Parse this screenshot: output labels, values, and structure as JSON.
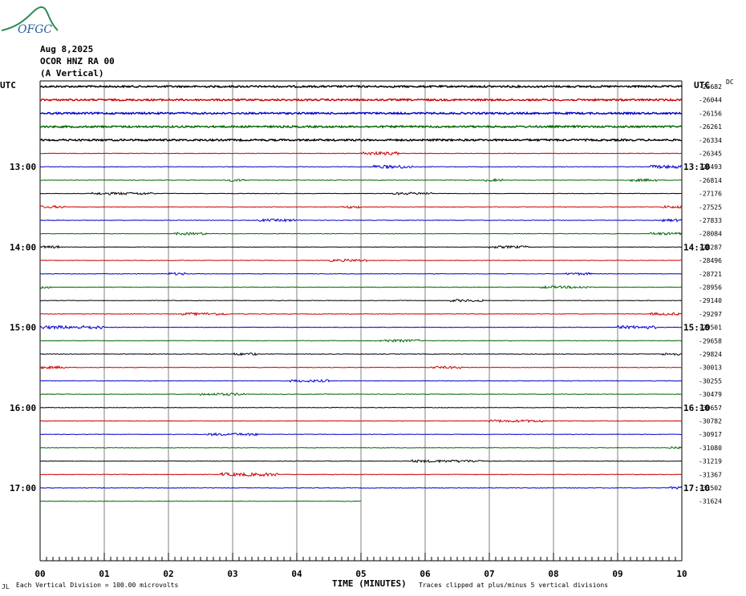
{
  "header": {
    "logo_text": "OFGC",
    "date": "Aug 8,2025",
    "station": "OCOR HNZ RA 00",
    "component": "(A Vertical)"
  },
  "colors": {
    "cycle": [
      "#000000",
      "#cc0000",
      "#0000cc",
      "#006600"
    ],
    "grid": "#808080",
    "logo": "#2e8b57"
  },
  "chart_data": {
    "type": "line",
    "title": "Aug 8,2025 OCOR HNZ RA 00 (A Vertical)",
    "xlabel": "TIME (MINUTES)",
    "ylabel": "UTC",
    "x_ticks": [
      "00",
      "01",
      "02",
      "03",
      "04",
      "05",
      "06",
      "07",
      "08",
      "09",
      "10"
    ],
    "xlim": [
      0,
      10
    ],
    "left_axis_label": "UTC",
    "right_axis_label": "UTC",
    "left_time_labels": [
      {
        "trace": 6,
        "label": "13:00"
      },
      {
        "trace": 12,
        "label": "14:00"
      },
      {
        "trace": 18,
        "label": "15:00"
      },
      {
        "trace": 24,
        "label": "16:00"
      },
      {
        "trace": 30,
        "label": "17:00"
      }
    ],
    "right_time_labels": [
      {
        "trace": 6,
        "label": "13:10"
      },
      {
        "trace": 12,
        "label": "14:10"
      },
      {
        "trace": 18,
        "label": "15:10"
      },
      {
        "trace": 24,
        "label": "16:10"
      },
      {
        "trace": 30,
        "label": "17:10"
      }
    ],
    "first_trace_note": "DC",
    "trace_offsets": [
      "-25682",
      "-26044",
      "-26156",
      "-26261",
      "-26334",
      "-26345",
      "-26493",
      "-26814",
      "-27176",
      "-27525",
      "-27833",
      "-28084",
      "-28287",
      "-28496",
      "-28721",
      "-28956",
      "-29140",
      "-29297",
      "-29501",
      "-29658",
      "-29824",
      "-30013",
      "-30255",
      "-30479",
      "-30657",
      "-30782",
      "-30917",
      "-31080",
      "-31219",
      "-31367",
      "-31502",
      "-31624"
    ],
    "last_trace_end_minute": 5,
    "bursts": [
      {
        "trace": 5,
        "start": 5.0,
        "end": 5.6,
        "amp": 2
      },
      {
        "trace": 6,
        "start": 5.2,
        "end": 5.8,
        "amp": 2
      },
      {
        "trace": 6,
        "start": 9.5,
        "end": 10.0,
        "amp": 2
      },
      {
        "trace": 7,
        "start": 2.9,
        "end": 3.2,
        "amp": 1.5
      },
      {
        "trace": 7,
        "start": 6.9,
        "end": 7.2,
        "amp": 1.5
      },
      {
        "trace": 7,
        "start": 9.2,
        "end": 9.6,
        "amp": 1.5
      },
      {
        "trace": 8,
        "start": 0.8,
        "end": 1.8,
        "amp": 1.5
      },
      {
        "trace": 8,
        "start": 5.5,
        "end": 6.1,
        "amp": 1.5
      },
      {
        "trace": 9,
        "start": 0.0,
        "end": 0.4,
        "amp": 1.5
      },
      {
        "trace": 9,
        "start": 4.7,
        "end": 5.0,
        "amp": 1.5
      },
      {
        "trace": 9,
        "start": 9.7,
        "end": 10.0,
        "amp": 1.5
      },
      {
        "trace": 10,
        "start": 3.4,
        "end": 4.0,
        "amp": 1.5
      },
      {
        "trace": 10,
        "start": 9.7,
        "end": 10.0,
        "amp": 1.5
      },
      {
        "trace": 11,
        "start": 2.1,
        "end": 2.6,
        "amp": 1.5
      },
      {
        "trace": 11,
        "start": 9.5,
        "end": 10.0,
        "amp": 1.5
      },
      {
        "trace": 12,
        "start": 0.0,
        "end": 0.3,
        "amp": 1.5
      },
      {
        "trace": 12,
        "start": 7.0,
        "end": 7.6,
        "amp": 1.5
      },
      {
        "trace": 13,
        "start": 4.5,
        "end": 5.1,
        "amp": 1.5
      },
      {
        "trace": 14,
        "start": 2.0,
        "end": 2.3,
        "amp": 1.5
      },
      {
        "trace": 14,
        "start": 8.2,
        "end": 8.6,
        "amp": 1.5
      },
      {
        "trace": 15,
        "start": 0.0,
        "end": 0.2,
        "amp": 1.5
      },
      {
        "trace": 15,
        "start": 7.8,
        "end": 8.6,
        "amp": 1.5
      },
      {
        "trace": 16,
        "start": 6.4,
        "end": 6.9,
        "amp": 1.5
      },
      {
        "trace": 17,
        "start": 2.2,
        "end": 2.9,
        "amp": 1.5
      },
      {
        "trace": 17,
        "start": 9.5,
        "end": 10.0,
        "amp": 1.5
      },
      {
        "trace": 18,
        "start": 0.0,
        "end": 1.0,
        "amp": 2
      },
      {
        "trace": 18,
        "start": 9.0,
        "end": 9.6,
        "amp": 2
      },
      {
        "trace": 19,
        "start": 5.3,
        "end": 5.9,
        "amp": 1.5
      },
      {
        "trace": 20,
        "start": 3.0,
        "end": 3.4,
        "amp": 1.5
      },
      {
        "trace": 20,
        "start": 9.7,
        "end": 10.0,
        "amp": 1.5
      },
      {
        "trace": 21,
        "start": 0.0,
        "end": 0.4,
        "amp": 1.5
      },
      {
        "trace": 21,
        "start": 6.1,
        "end": 6.6,
        "amp": 1.5
      },
      {
        "trace": 22,
        "start": 3.9,
        "end": 4.5,
        "amp": 1.5
      },
      {
        "trace": 23,
        "start": 2.5,
        "end": 3.2,
        "amp": 1.5
      },
      {
        "trace": 25,
        "start": 7.0,
        "end": 7.9,
        "amp": 1.5
      },
      {
        "trace": 26,
        "start": 2.6,
        "end": 3.4,
        "amp": 1.5
      },
      {
        "trace": 27,
        "start": 9.8,
        "end": 10.0,
        "amp": 1.5
      },
      {
        "trace": 28,
        "start": 5.8,
        "end": 6.9,
        "amp": 1.5
      },
      {
        "trace": 29,
        "start": 2.8,
        "end": 3.7,
        "amp": 2
      },
      {
        "trace": 30,
        "start": 9.8,
        "end": 10.0,
        "amp": 1.5
      }
    ]
  },
  "footer": {
    "mark": "JL",
    "division_note": "Each Vertical Division =  100.00 microvolts",
    "clip_note": "Traces clipped at plus/minus 5 vertical divisions"
  }
}
